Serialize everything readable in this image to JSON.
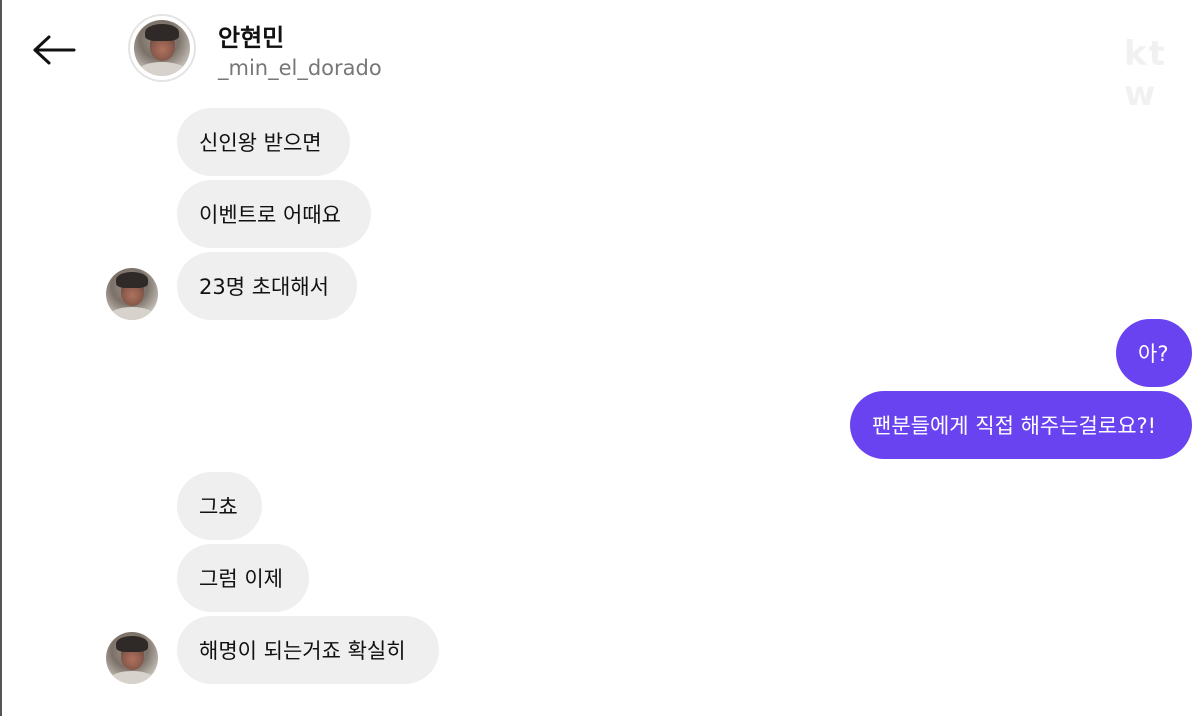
{
  "header": {
    "back_icon": "arrow-left-icon",
    "contact_name": "안현민",
    "contact_username": "_min_el_dorado",
    "avatar_icon": "profile-photo"
  },
  "watermark": "kt w",
  "colors": {
    "outgoing_bubble": "#6a43f0",
    "incoming_bubble": "#efefef",
    "username_text": "#777777"
  },
  "messages": [
    {
      "sender": "them",
      "text": "신인왕 받으면"
    },
    {
      "sender": "them",
      "text": "이벤트로 어때요"
    },
    {
      "sender": "them",
      "text": "23명 초대해서"
    },
    {
      "sender": "me",
      "text": "아?"
    },
    {
      "sender": "me",
      "text": "팬분들에게 직접 해주는걸로요?!"
    },
    {
      "sender": "them",
      "text": "그쵸"
    },
    {
      "sender": "them",
      "text": "그럼 이제"
    },
    {
      "sender": "them",
      "text": "해명이 되는거죠 확실히"
    }
  ]
}
